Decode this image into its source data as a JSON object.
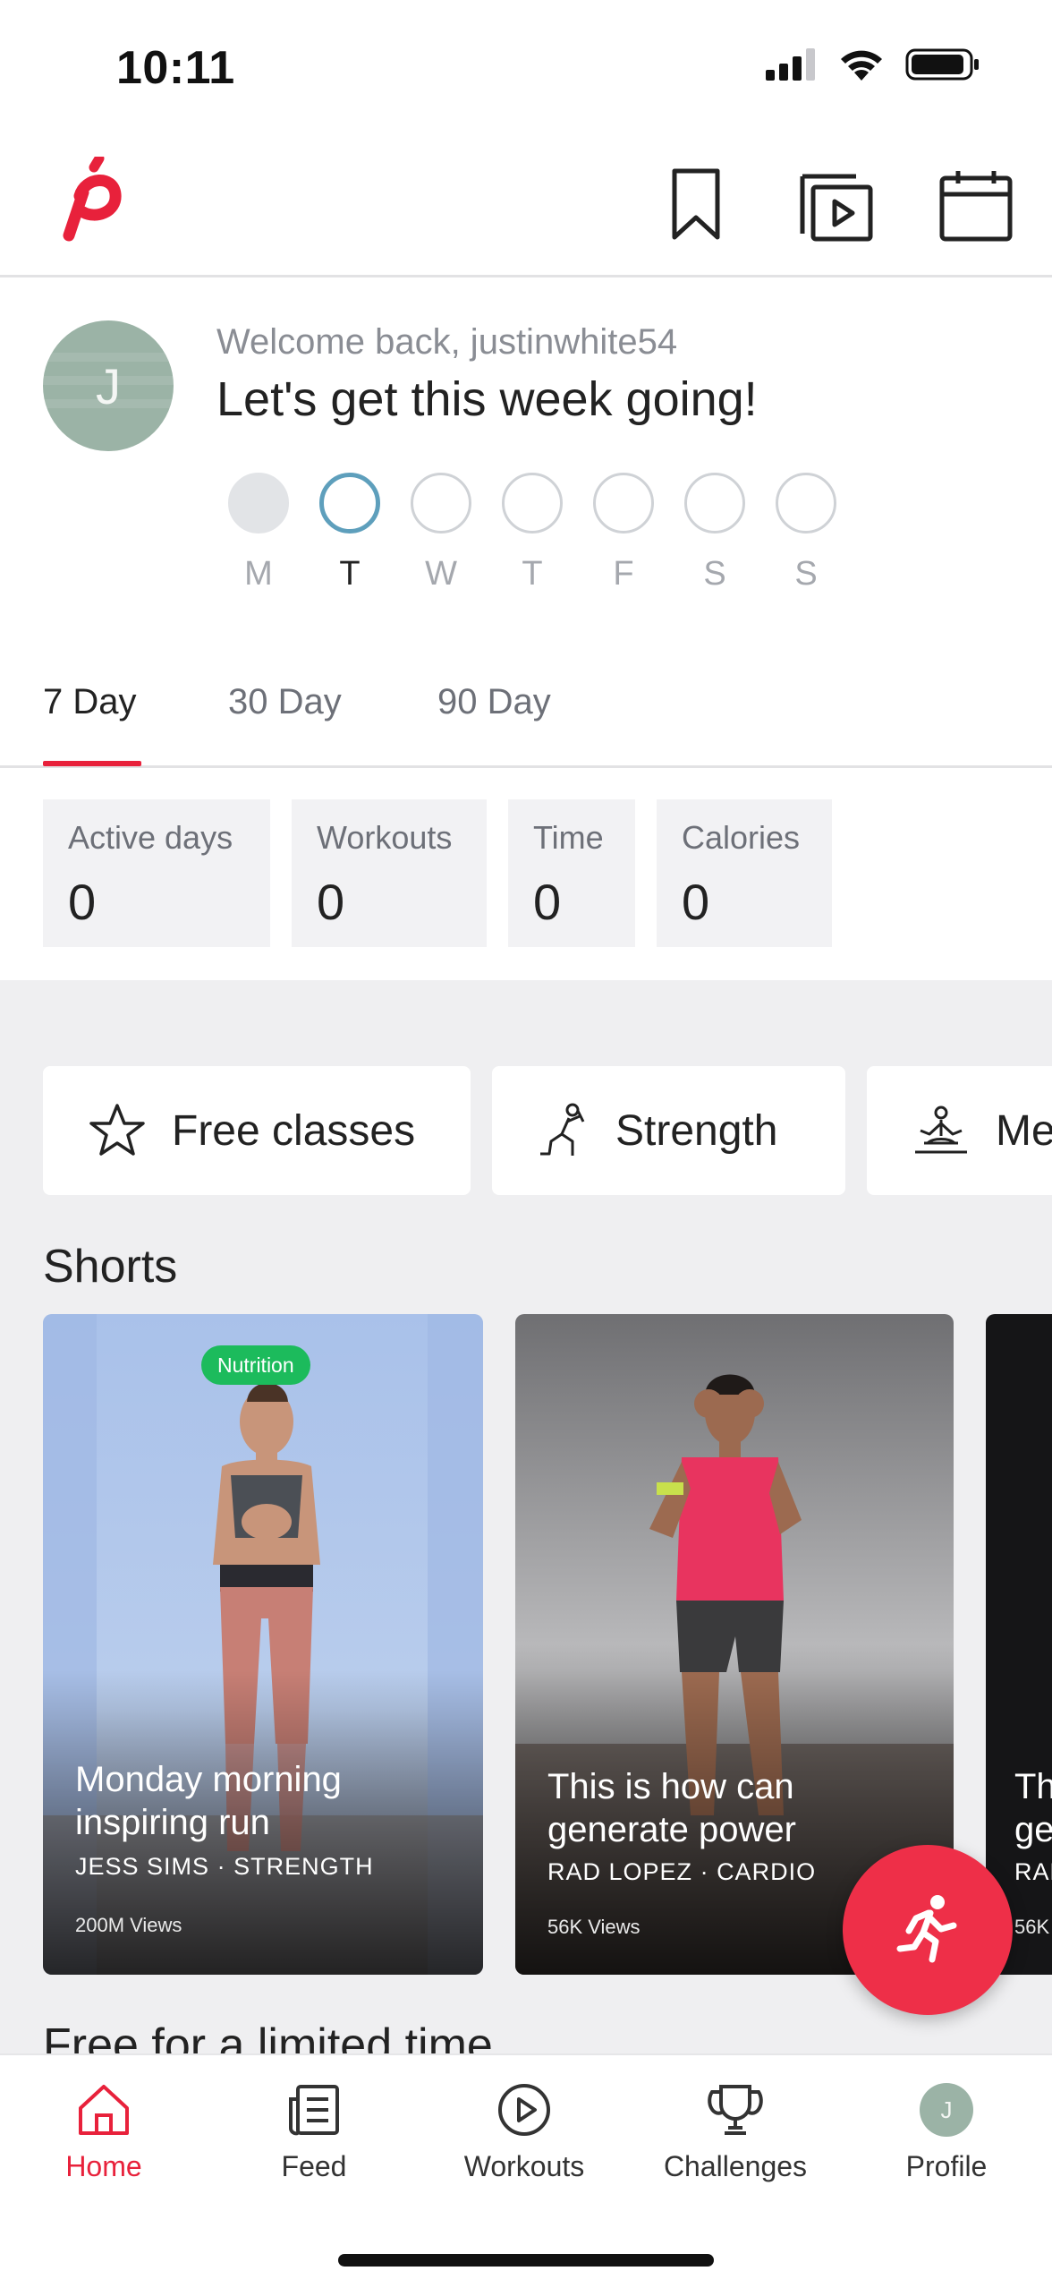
{
  "status_bar": {
    "time": "10:11"
  },
  "welcome": {
    "avatar_initial": "J",
    "subtitle": "Welcome back, justinwhite54",
    "title": "Let's get this week going!",
    "days": [
      "M",
      "T",
      "W",
      "T",
      "F",
      "S",
      "S"
    ],
    "today_index": 1
  },
  "range_tabs": [
    "7 Day",
    "30 Day",
    "90 Day"
  ],
  "active_range": "7 Day",
  "stats": [
    {
      "label": "Active days",
      "value": "0"
    },
    {
      "label": "Workouts",
      "value": "0"
    },
    {
      "label": "Time",
      "value": "0"
    },
    {
      "label": "Calories",
      "value": "0"
    }
  ],
  "categories": [
    {
      "label": "Free classes",
      "icon": "star-icon"
    },
    {
      "label": "Strength",
      "icon": "strength-icon"
    },
    {
      "label": "Me",
      "icon": "meditation-icon"
    }
  ],
  "shorts": {
    "title": "Shorts",
    "cards": [
      {
        "badge": "Nutrition",
        "title_line1": "Monday morning",
        "title_line2": "inspiring run",
        "instructor": "JESS SIMS",
        "category": "STRENGTH",
        "views": "200M Views"
      },
      {
        "title_line1": "This is how can",
        "title_line2": "generate power",
        "instructor": "RAD LOPEZ",
        "category": "CARDIO",
        "views": "56K Views"
      },
      {
        "title_line1": "Th",
        "title_line2": "ge",
        "instructor": "RAD",
        "views": "56K"
      }
    ]
  },
  "free_section_title": "Free for a limited time",
  "nav": [
    {
      "label": "Home",
      "icon": "home-icon",
      "active": true
    },
    {
      "label": "Feed",
      "icon": "feed-icon",
      "active": false
    },
    {
      "label": "Workouts",
      "icon": "play-circle-icon",
      "active": false
    },
    {
      "label": "Challenges",
      "icon": "trophy-icon",
      "active": false
    },
    {
      "label": "Profile",
      "icon": "avatar",
      "active": false
    }
  ],
  "profile_initial": "J",
  "colors": {
    "brand_red": "#e8213b",
    "fab_red": "#ee2f48",
    "today_ring": "#5e9fbc",
    "nutrition_badge": "#1cbb5c"
  }
}
